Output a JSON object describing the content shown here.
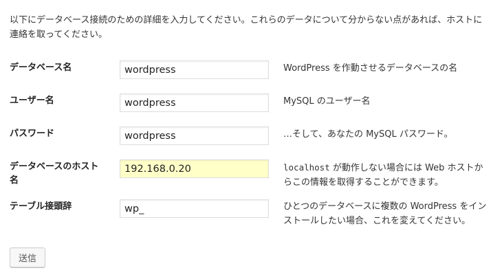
{
  "intro": "以下にデータベース接続のための詳細を入力してください。これらのデータについて分からない点があれば、ホストに連絡を取ってください。",
  "form": {
    "rows": [
      {
        "label": "データベース名",
        "value": "wordpress",
        "description": "WordPress を作動させるデータベースの名"
      },
      {
        "label": "ユーザー名",
        "value": "wordpress",
        "description": "MySQL のユーザー名"
      },
      {
        "label": "パスワード",
        "value": "wordpress",
        "description": "…そして、あなたの MySQL パスワード。"
      },
      {
        "label": "データベースのホスト名",
        "value": "192.168.0.20",
        "description_code": "localhost",
        "description_rest": " が動作しない場合には Web ホストからこの情報を取得することができます。"
      },
      {
        "label": "テーブル接頭辞",
        "value": "wp_",
        "description": "ひとつのデータベースに複数の WordPress をインストールしたい場合、これを変えてください。"
      }
    ],
    "submit_label": "送信"
  },
  "colors": {
    "highlighted_field_bg": "#ffffc8",
    "text": "#333333",
    "border": "#dddddd"
  }
}
